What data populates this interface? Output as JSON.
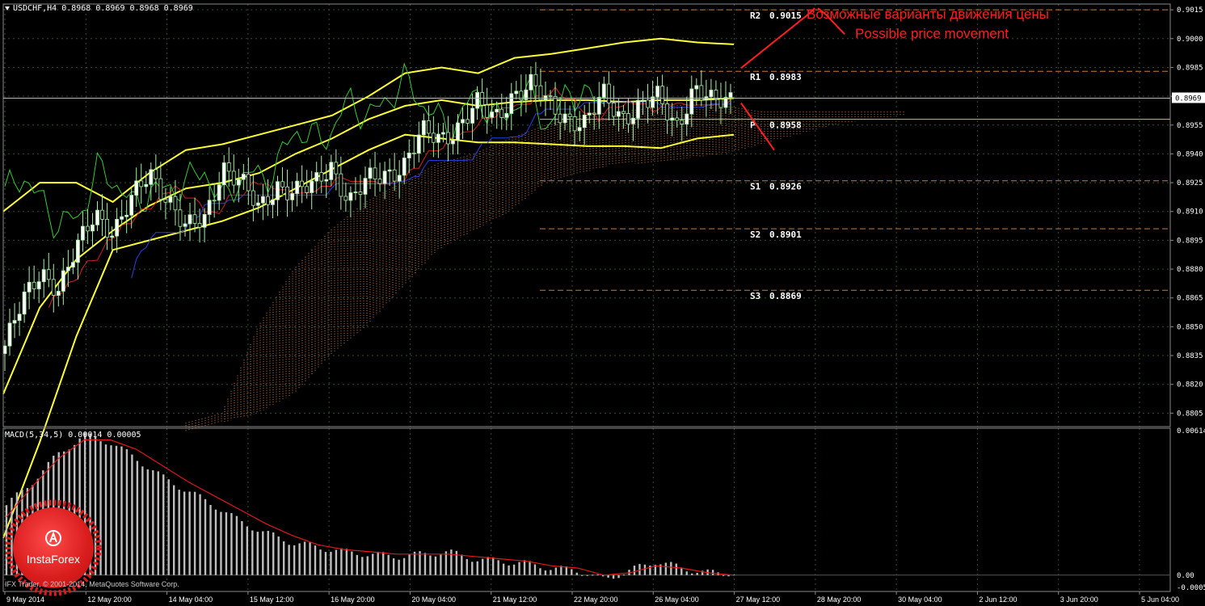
{
  "header": {
    "main": "USDCHF,H4  0.8968 0.8969 0.8968 0.8969",
    "macd": "MACD(5,34,5) 0.00014 0.00005"
  },
  "annotation": {
    "ru": "Возможные варианты движения цены",
    "en": "Possible price movement"
  },
  "copyright": "IFX Trader, © 2001-2014, MetaQuotes Software Corp.",
  "logo": {
    "text": "InstaForex"
  },
  "colors": {
    "background": "#000000",
    "grid": "#2e4f2e",
    "candle_up": "#ffffff",
    "candle_down": "#000000",
    "candle_wick": "#a8f0a8",
    "bollinger": "#ffff33",
    "tenkan": "#d81c1c",
    "kijun": "#2b3fe6",
    "chikou": "#33cc33",
    "kumo": "#ff9a52",
    "pivot_line": "#c87a3a",
    "level_label": "#ffffff",
    "annotation": "#ff1e1e",
    "macd_hist": "#bdbdbd",
    "macd_signal": "#e01818",
    "price_tag_bg": "#ffffff"
  },
  "chart_data": [
    {
      "type": "candlestick",
      "title": "USDCHF,H4",
      "ylim": [
        0.8798,
        0.9018
      ],
      "y_ticks": [
        "0.9015",
        "0.9000",
        "0.8985",
        "0.8970",
        "0.8955",
        "0.8940",
        "0.8925",
        "0.8910",
        "0.8895",
        "0.8880",
        "0.8865",
        "0.8850",
        "0.8835",
        "0.8820",
        "0.8805"
      ],
      "x_ticks": [
        "9 May 2014",
        "12 May 20:00",
        "14 May 04:00",
        "15 May 12:00",
        "16 May 20:00",
        "20 May 04:00",
        "21 May 12:00",
        "22 May 20:00",
        "26 May 04:00",
        "27 May 12:00",
        "28 May 20:00",
        "30 May 04:00",
        "2 Jun 12:00",
        "3 Jun 20:00",
        "5 Jun 04:00"
      ],
      "current_price": "0.8969",
      "pivot_levels": [
        {
          "label": "R2",
          "value": "0.9015"
        },
        {
          "label": "R1",
          "value": "0.8983"
        },
        {
          "label": "P",
          "value": "0.8958"
        },
        {
          "label": "S1",
          "value": "0.8926"
        },
        {
          "label": "S2",
          "value": "0.8901"
        },
        {
          "label": "S3",
          "value": "0.8869"
        }
      ],
      "pivot_numeric": [
        0.9015,
        0.8983,
        0.8958,
        0.8926,
        0.8901,
        0.8869
      ],
      "close_start": 0.884,
      "close_path": [
        0.884,
        0.8862,
        0.888,
        0.887,
        0.889,
        0.891,
        0.89,
        0.8915,
        0.893,
        0.8918,
        0.89,
        0.8905,
        0.8935,
        0.8925,
        0.891,
        0.8925,
        0.892,
        0.8922,
        0.8935,
        0.8915,
        0.8925,
        0.893,
        0.8935,
        0.895,
        0.8948,
        0.8955,
        0.8965,
        0.8958,
        0.8972,
        0.8975,
        0.8965,
        0.896,
        0.8955,
        0.897,
        0.896,
        0.8965,
        0.8968,
        0.8955,
        0.8975,
        0.8965,
        0.8969
      ],
      "close_x_ticks": [
        0,
        3,
        6,
        9,
        12,
        15,
        18,
        21,
        24,
        27,
        30,
        33,
        36,
        39,
        40
      ],
      "bb_upper": [
        0.891,
        0.8925,
        0.8925,
        0.8915,
        0.893,
        0.8942,
        0.8945,
        0.895,
        0.8955,
        0.896,
        0.897,
        0.8982,
        0.8985,
        0.8982,
        0.899,
        0.8992,
        0.8995,
        0.8998,
        0.9,
        0.8998,
        0.8997
      ],
      "bb_middle": [
        0.8815,
        0.886,
        0.8885,
        0.89,
        0.8913,
        0.8922,
        0.8925,
        0.893,
        0.894,
        0.8948,
        0.8958,
        0.8965,
        0.8968,
        0.8965,
        0.8967,
        0.8968,
        0.8968,
        0.8967,
        0.8968,
        0.8968,
        0.8969
      ],
      "bb_lower": [
        0.874,
        0.879,
        0.8845,
        0.889,
        0.8895,
        0.89,
        0.8905,
        0.8912,
        0.8922,
        0.8932,
        0.8942,
        0.895,
        0.8948,
        0.8946,
        0.8946,
        0.8945,
        0.8944,
        0.8944,
        0.8943,
        0.8948,
        0.895
      ],
      "kumo_top": [
        0.88,
        0.8805,
        0.885,
        0.888,
        0.89,
        0.8915,
        0.8925,
        0.8935,
        0.894,
        0.8948,
        0.8955,
        0.896,
        0.8962,
        0.8964,
        0.8966,
        0.8965,
        0.8962,
        0.8962,
        0.8962,
        0.8962,
        0.8962
      ],
      "kumo_bottom": [
        0.8795,
        0.88,
        0.8805,
        0.8815,
        0.8835,
        0.885,
        0.887,
        0.889,
        0.89,
        0.891,
        0.8925,
        0.893,
        0.8935,
        0.8935,
        0.8938,
        0.894,
        0.8945,
        0.895,
        0.8955,
        0.8958,
        0.896
      ]
    },
    {
      "type": "bar",
      "title": "MACD(5,34,5)",
      "ylim": [
        -7e-05,
        0.00063
      ],
      "y_ticks": [
        "0.00614",
        "0.00",
        "-0.00054"
      ],
      "values": [
        0.0003,
        0.0004,
        0.00052,
        0.0006,
        0.00057,
        0.0005,
        0.00042,
        0.00036,
        0.0003,
        0.00023,
        0.00018,
        0.00014,
        0.00012,
        0.0001,
        9e-05,
        8e-05,
        9e-05,
        0.0001,
        7e-05,
        6e-05,
        5e-05,
        3e-05,
        2e-05,
        -2e-05,
        2e-05,
        6e-05,
        3e-05,
        1e-05,
        1e-05
      ],
      "signal": [
        0.00025,
        0.00038,
        0.0005,
        0.00058,
        0.00058,
        0.00054,
        0.00047,
        0.0004,
        0.00034,
        0.00028,
        0.00022,
        0.00017,
        0.00013,
        0.00011,
        0.0001,
        9e-05,
        9e-05,
        9e-05,
        8e-05,
        7e-05,
        6e-05,
        4e-05,
        3e-05,
        0.0,
        1e-05,
        4e-05,
        3e-05,
        1e-05,
        0.0
      ]
    }
  ]
}
